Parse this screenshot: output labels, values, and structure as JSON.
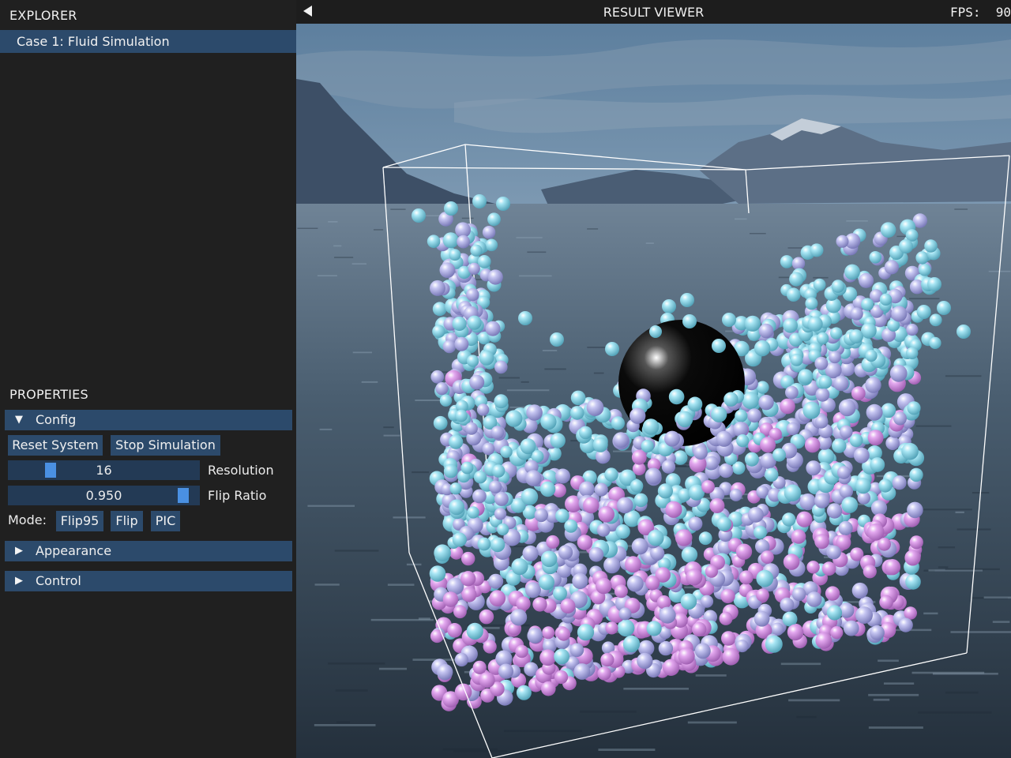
{
  "explorer": {
    "title": "EXPLORER",
    "items": [
      {
        "label": "Case 1: Fluid Simulation",
        "selected": true
      }
    ]
  },
  "properties": {
    "title": "PROPERTIES",
    "config": {
      "header": "Config",
      "expanded": true,
      "reset_label": "Reset System",
      "stop_label": "Stop Simulation",
      "resolution": {
        "value": "16",
        "label": "Resolution"
      },
      "flip_ratio": {
        "value": "0.950",
        "label": "Flip Ratio"
      },
      "mode": {
        "label": "Mode:",
        "options": [
          "Flip95",
          "Flip",
          "PIC"
        ]
      }
    },
    "appearance": {
      "header": "Appearance",
      "expanded": false
    },
    "control": {
      "header": "Control",
      "expanded": false
    }
  },
  "viewer": {
    "title": "RESULT VIEWER",
    "fps_label": "FPS:",
    "fps_value": "90"
  },
  "colors": {
    "panel_bg": "#202020",
    "header_blue": "#2c4a6b",
    "slider_bg": "#233a55",
    "slider_knob": "#4a90e2",
    "particle_cyan": "#8fd6e8",
    "particle_lavender": "#b4b4ea",
    "particle_pink": "#d79ae6",
    "obstacle_sphere": "#000000"
  },
  "icons": {
    "back": "triangle-left-icon",
    "expanded": "triangle-down-icon",
    "collapsed": "triangle-right-icon"
  }
}
